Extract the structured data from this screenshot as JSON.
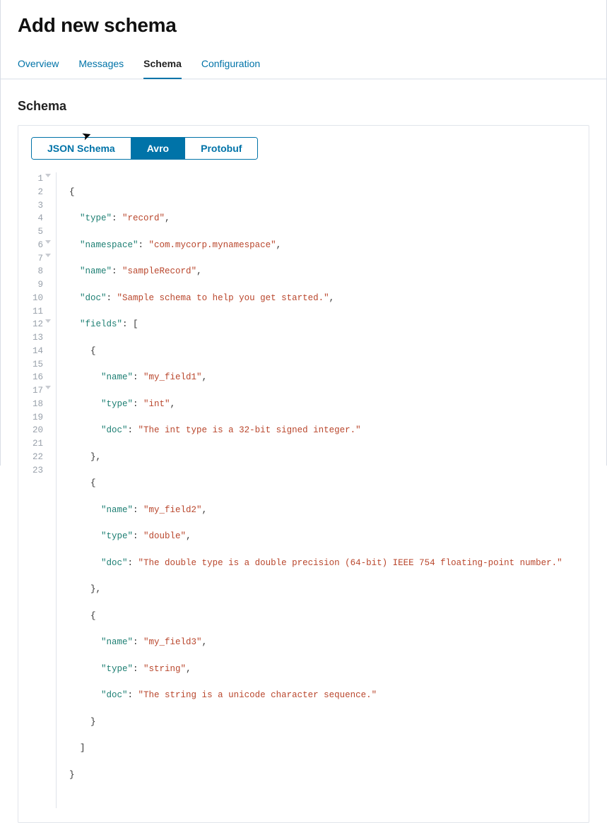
{
  "page": {
    "title": "Add new schema"
  },
  "nav": {
    "tabs": [
      {
        "label": "Overview"
      },
      {
        "label": "Messages"
      },
      {
        "label": "Schema"
      },
      {
        "label": "Configuration"
      }
    ],
    "active_index": 2
  },
  "section": {
    "title": "Schema"
  },
  "schema_types": {
    "options": [
      {
        "label": "JSON Schema"
      },
      {
        "label": "Avro"
      },
      {
        "label": "Protobuf"
      }
    ],
    "active_index": 1
  },
  "editor": {
    "lines": [
      {
        "n": "1",
        "fold": true
      },
      {
        "n": "2"
      },
      {
        "n": "3"
      },
      {
        "n": "4"
      },
      {
        "n": "5"
      },
      {
        "n": "6",
        "fold": true
      },
      {
        "n": "7",
        "fold": true
      },
      {
        "n": "8"
      },
      {
        "n": "9"
      },
      {
        "n": "10"
      },
      {
        "n": "11"
      },
      {
        "n": "12",
        "fold": true
      },
      {
        "n": "13"
      },
      {
        "n": "14"
      },
      {
        "n": "15"
      },
      {
        "n": "16"
      },
      {
        "n": "17",
        "fold": true
      },
      {
        "n": "18"
      },
      {
        "n": "19"
      },
      {
        "n": "20"
      },
      {
        "n": "21"
      },
      {
        "n": "22"
      },
      {
        "n": "23"
      }
    ],
    "schema": {
      "type": "record",
      "namespace": "com.mycorp.mynamespace",
      "name": "sampleRecord",
      "doc": "Sample schema to help you get started.",
      "fields": [
        {
          "name": "my_field1",
          "type": "int",
          "doc": "The int type is a 32-bit signed integer."
        },
        {
          "name": "my_field2",
          "type": "double",
          "doc": "The double type is a double precision (64-bit) IEEE 754 floating-point number."
        },
        {
          "name": "my_field3",
          "type": "string",
          "doc": "The string is a unicode character sequence."
        }
      ]
    },
    "k": {
      "type": "\"type\"",
      "namespace": "\"namespace\"",
      "name": "\"name\"",
      "doc": "\"doc\"",
      "fields": "\"fields\""
    },
    "v": {
      "type": "\"record\"",
      "namespace": "\"com.mycorp.mynamespace\"",
      "name": "\"sampleRecord\"",
      "doc": "\"Sample schema to help you get started.\"",
      "f1_name": "\"my_field1\"",
      "f1_type": "\"int\"",
      "f1_doc": "\"The int type is a 32-bit signed integer.\"",
      "f2_name": "\"my_field2\"",
      "f2_type": "\"double\"",
      "f2_doc": "\"The double type is a double precision (64-bit) IEEE 754 floating-point number.\"",
      "f3_name": "\"my_field3\"",
      "f3_type": "\"string\"",
      "f3_doc": "\"The string is a unicode character sequence.\""
    },
    "p": {
      "open_brace": "{",
      "close_brace": "}",
      "open_bracket": "[",
      "close_bracket": "]",
      "colon_sp": ": ",
      "comma": ",",
      "close_brace_comma": "},"
    }
  },
  "colors": {
    "accent": "#0073a8",
    "key": "#1c7e72",
    "string": "#b9462c"
  }
}
